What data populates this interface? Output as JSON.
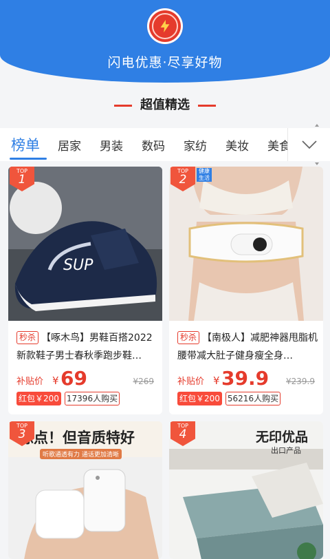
{
  "header": {
    "tagline": "闪电优惠·尽享好物",
    "logo_icon": "lightning-icon",
    "colors": {
      "blue": "#2f7fe4",
      "red": "#e53b2c"
    }
  },
  "section": {
    "title": "超值精选"
  },
  "tabs": [
    "榜单",
    "居家",
    "男装",
    "数码",
    "家纺",
    "美妆",
    "美食"
  ],
  "products": [
    {
      "rank_label": "TOP",
      "rank": "1",
      "badge": "秒杀",
      "title": "【啄木鸟】男鞋百搭2022新款鞋子男士春秋季跑步鞋…",
      "price_label": "补贴价",
      "currency": "¥",
      "price": "69",
      "original_price": "¥269",
      "coupon": "红包￥200",
      "sold": "17396人购买",
      "image_theme": "navy-sneaker"
    },
    {
      "rank_label": "TOP",
      "rank": "2",
      "badge": "秒杀",
      "title": "【南极人】减肥神器甩脂机腰带减大肚子健身瘦全身…",
      "price_label": "补贴价",
      "currency": "¥",
      "price": "39.9",
      "original_price": "¥239.9",
      "coupon": "红包￥200",
      "sold": "56216人购买",
      "health_tag": "健康生活",
      "image_theme": "slimming-belt"
    },
    {
      "rank_label": "TOP",
      "rank": "3",
      "banner_text": "惊点！但音质特好",
      "banner_sub": "听歌通透有力  通话更加清晰",
      "image_theme": "earbuds"
    },
    {
      "rank_label": "TOP",
      "rank": "4",
      "brand": "无印优品",
      "brand_sub": "出口产品",
      "image_theme": "quilt"
    }
  ]
}
